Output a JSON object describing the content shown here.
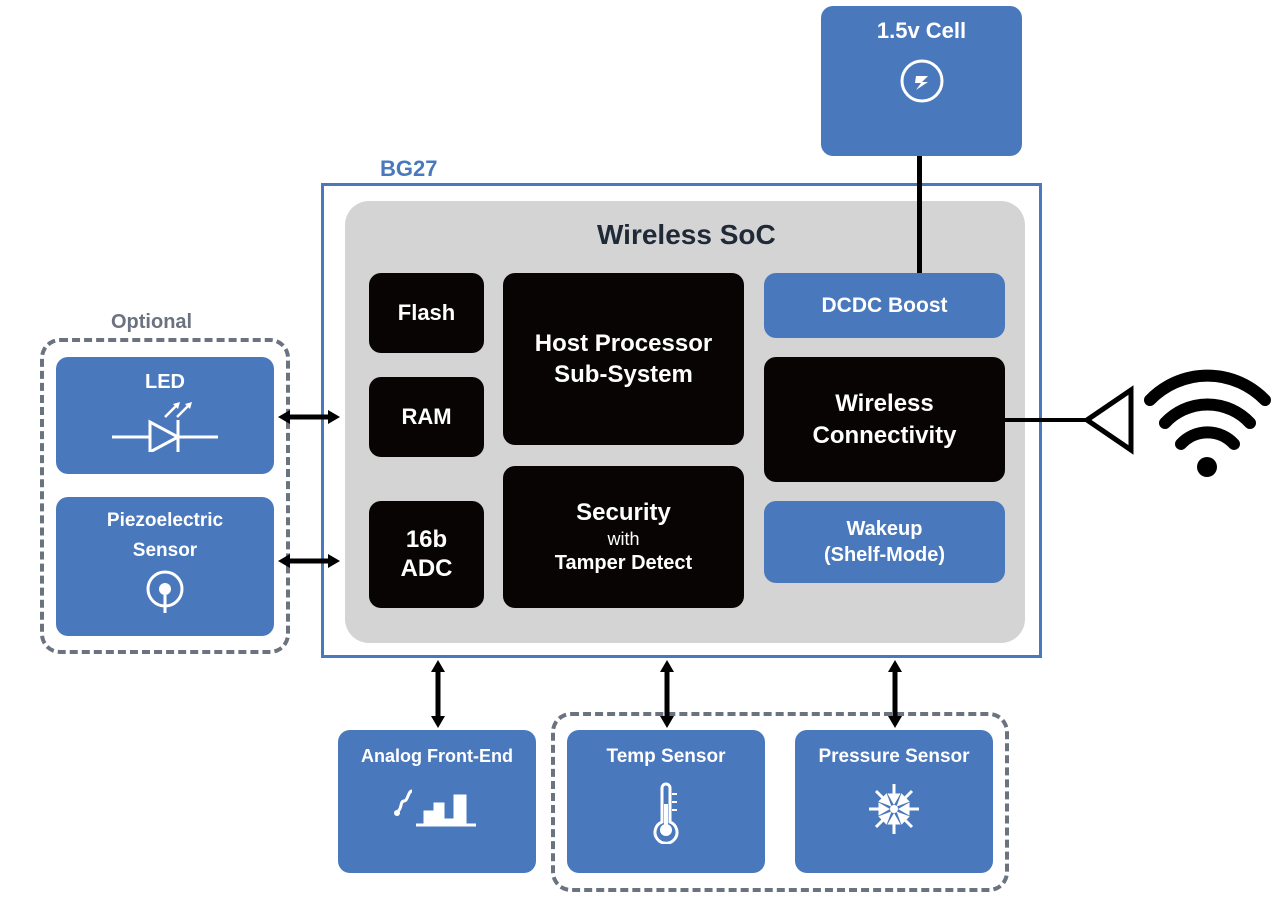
{
  "labels": {
    "bg27": "BG27",
    "soc": "Wireless SoC",
    "optional": "Optional"
  },
  "blocks": {
    "cell": "1.5v Cell",
    "flash": "Flash",
    "ram": "RAM",
    "adc_l1": "16b",
    "adc_l2": "ADC",
    "host_l1": "Host Processor",
    "host_l2": "Sub-System",
    "security_l1": "Security",
    "security_l2": "with",
    "security_l3": "Tamper Detect",
    "dcdc": "DCDC Boost",
    "wireless_l1": "Wireless",
    "wireless_l2": "Connectivity",
    "wakeup_l1": "Wakeup",
    "wakeup_l2": "(Shelf-Mode)",
    "led": "LED",
    "piezo_l1": "Piezoelectric",
    "piezo_l2": "Sensor",
    "afe": "Analog Front-End",
    "temp": "Temp Sensor",
    "pressure": "Pressure Sensor"
  }
}
